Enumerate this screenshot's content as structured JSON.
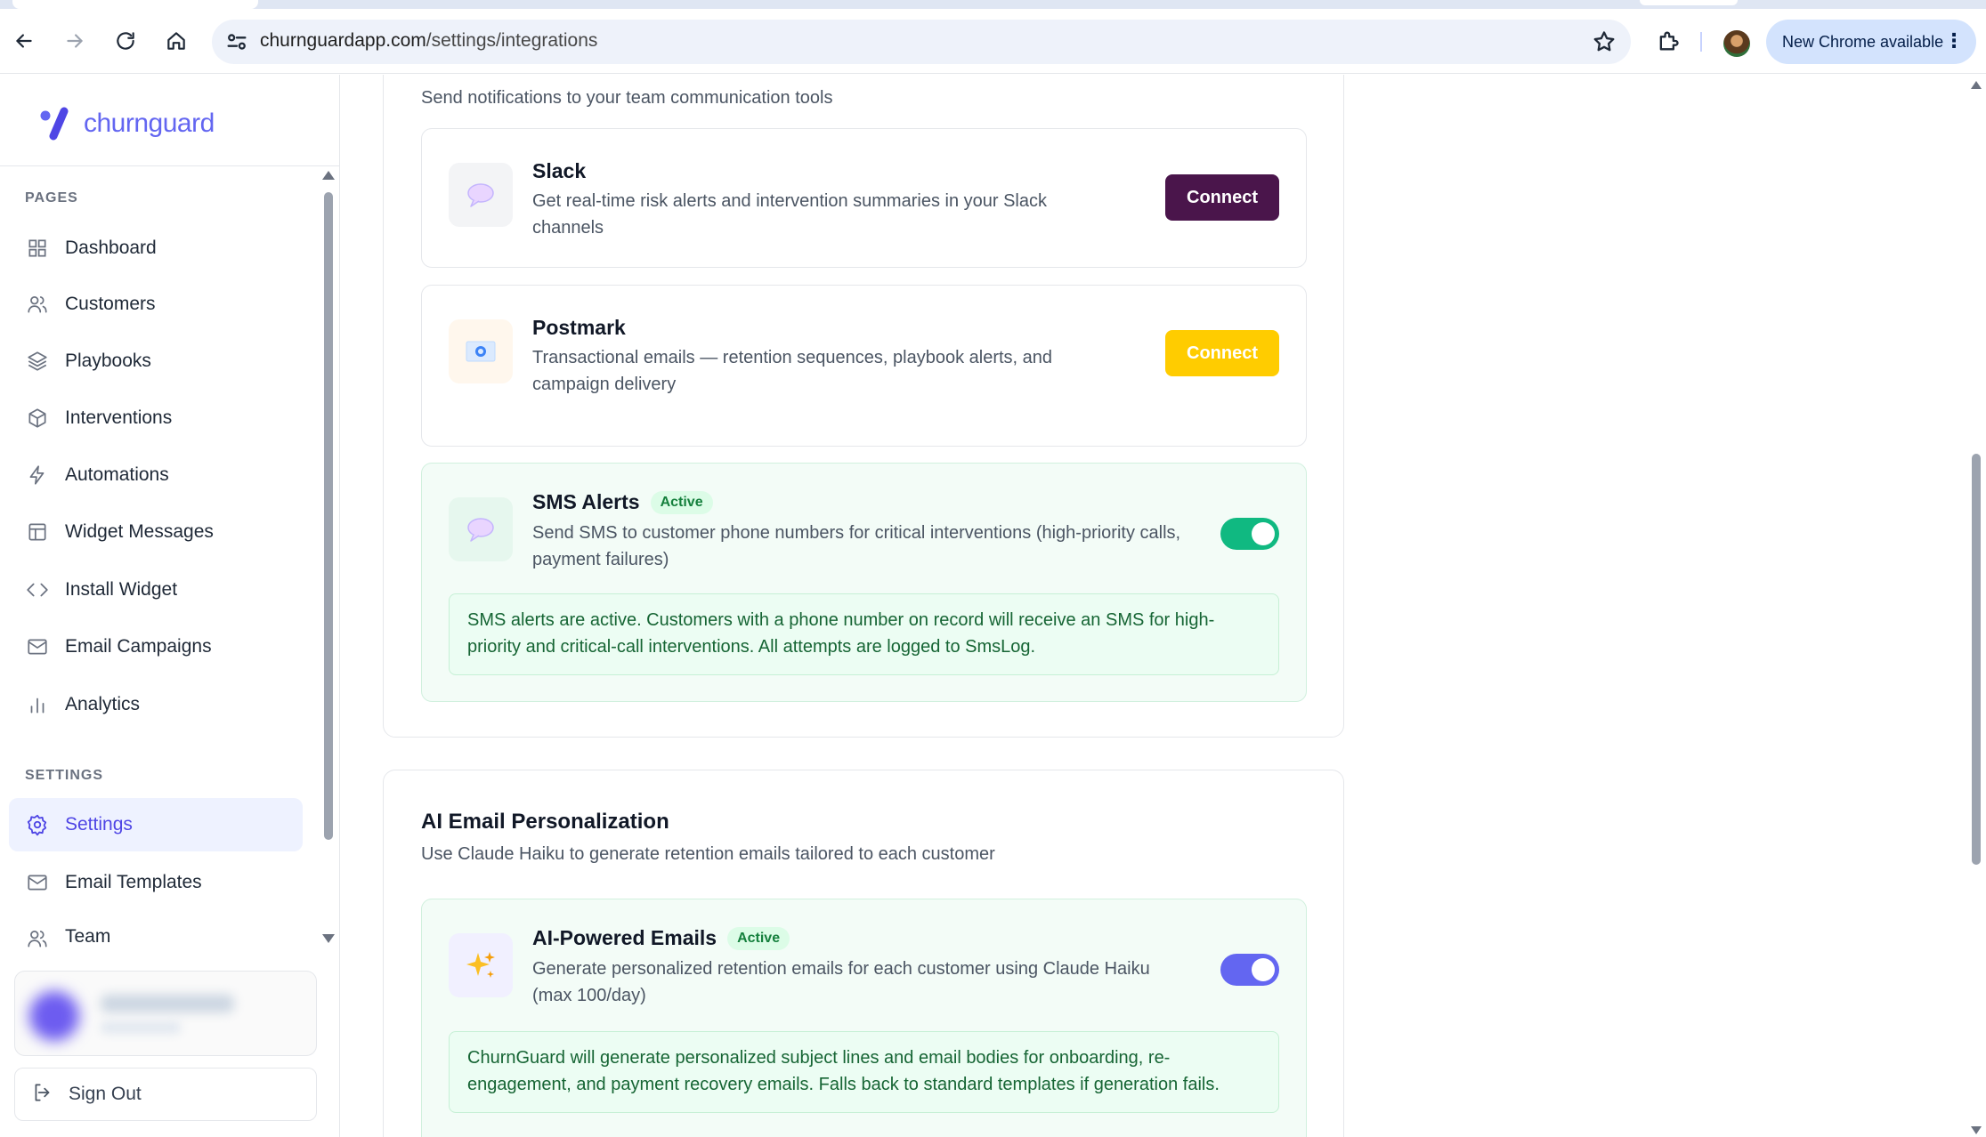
{
  "browser": {
    "url_host": "churnguardapp.com",
    "url_path": "/settings/integrations",
    "update_label": "New Chrome available"
  },
  "sidebar": {
    "brand": "churnguard",
    "pages_label": "PAGES",
    "settings_label": "SETTINGS",
    "pages": [
      {
        "label": "Dashboard",
        "icon": "grid-icon"
      },
      {
        "label": "Customers",
        "icon": "users-icon"
      },
      {
        "label": "Playbooks",
        "icon": "layers-icon"
      },
      {
        "label": "Interventions",
        "icon": "box-icon"
      },
      {
        "label": "Automations",
        "icon": "lightning-icon"
      },
      {
        "label": "Widget Messages",
        "icon": "layout-icon"
      },
      {
        "label": "Install Widget",
        "icon": "code-icon"
      },
      {
        "label": "Email Campaigns",
        "icon": "mail-icon"
      },
      {
        "label": "Analytics",
        "icon": "bar-chart-icon"
      }
    ],
    "settings": [
      {
        "label": "Settings",
        "icon": "gear-icon",
        "active": true
      },
      {
        "label": "Email Templates",
        "icon": "mail-icon"
      },
      {
        "label": "Team",
        "icon": "users-icon"
      }
    ],
    "sign_out": "Sign Out"
  },
  "notifications": {
    "subtitle": "Send notifications to your team communication tools",
    "integrations": [
      {
        "name": "Slack",
        "description": "Get real-time risk alerts and intervention summaries in your Slack channels",
        "action": "Connect",
        "icon": "speech-bubble-icon",
        "button_color": "#4a154b",
        "button_text_color": "#ffffff"
      },
      {
        "name": "Postmark",
        "description": "Transactional emails — retention sequences, playbook alerts, and campaign delivery",
        "action": "Connect",
        "icon": "email-envelope-icon",
        "button_color": "#ffcc00",
        "button_text_color": "#ffffff"
      },
      {
        "name": "SMS Alerts",
        "badge": "Active",
        "description": "Send SMS to customer phone numbers for critical interventions (high-priority calls, payment failures)",
        "enabled": true,
        "toggle_color": "#10b981",
        "icon": "speech-bubble-icon",
        "note": "SMS alerts are active. Customers with a phone number on record will receive an SMS for high-priority and critical-call interventions. All attempts are logged to SmsLog."
      }
    ]
  },
  "ai_email": {
    "title": "AI Email Personalization",
    "subtitle": "Use Claude Haiku to generate retention emails tailored to each customer",
    "feature": {
      "name": "AI-Powered Emails",
      "badge": "Active",
      "description": "Generate personalized retention emails for each customer using Claude Haiku (max 100/day)",
      "enabled": true,
      "toggle_color": "#6366f1",
      "icon": "sparkles-icon",
      "note": "ChurnGuard will generate personalized subject lines and email bodies for onboarding, re-engagement, and payment recovery emails. Falls back to standard templates if generation fails."
    }
  },
  "colors": {
    "accent": "#6366f1",
    "success": "#10b981",
    "slack": "#4a154b",
    "postmark": "#ffcc00"
  }
}
